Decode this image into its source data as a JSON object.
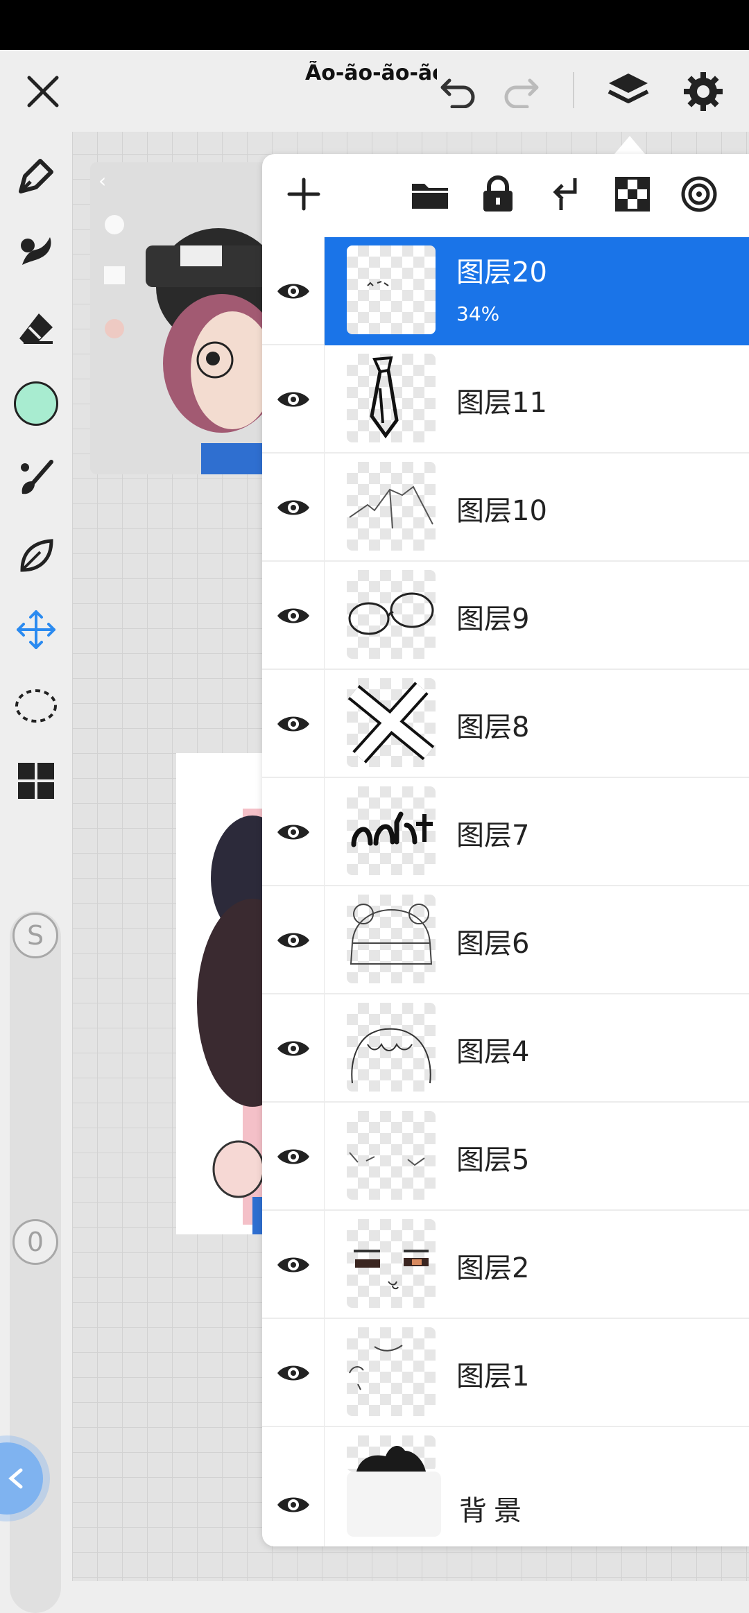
{
  "document": {
    "title": "Ão-ão-ão-ão"
  },
  "colors": {
    "accent": "#1a74e8",
    "current_color": "#a8ecd0",
    "tool_selected": "#2a8af0"
  },
  "top_bar": {
    "close_icon": "close-icon",
    "undo_icon": "undo-icon",
    "redo_icon": "redo-icon",
    "layers_icon": "layers-icon",
    "settings_icon": "gear-icon"
  },
  "left_toolbar": {
    "tools": [
      "pen-icon",
      "smudge-icon",
      "eraser-icon",
      "color-swatch",
      "brush-icon",
      "leaf-icon",
      "move-icon",
      "lasso-icon",
      "grid-icon"
    ],
    "selected_tool": "move-icon",
    "size_slider_label": "S",
    "opacity_slider_label": "0"
  },
  "layers_panel": {
    "toolbar": [
      "add-layer-icon",
      "folder-icon",
      "lock-icon",
      "merge-down-icon",
      "alpha-icon",
      "target-icon"
    ],
    "layers": [
      {
        "name": "图层20",
        "opacity": "34%",
        "selected": true,
        "alpha_lock": false,
        "thumb": "dots"
      },
      {
        "name": "图层11",
        "selected": false,
        "alpha_lock": false,
        "thumb": "tie"
      },
      {
        "name": "图层10",
        "selected": false,
        "alpha_lock": true,
        "thumb": "collar"
      },
      {
        "name": "图层9",
        "selected": false,
        "alpha_lock": false,
        "thumb": "glasses"
      },
      {
        "name": "图层8",
        "selected": false,
        "alpha_lock": false,
        "thumb": "cross"
      },
      {
        "name": "图层7",
        "selected": false,
        "alpha_lock": false,
        "thumb": "cat-text"
      },
      {
        "name": "图层6",
        "selected": false,
        "alpha_lock": false,
        "thumb": "hat"
      },
      {
        "name": "图层4",
        "selected": false,
        "alpha_lock": false,
        "thumb": "hair"
      },
      {
        "name": "图层5",
        "selected": false,
        "alpha_lock": false,
        "thumb": "lines"
      },
      {
        "name": "图层2",
        "selected": false,
        "alpha_lock": true,
        "thumb": "eyes"
      },
      {
        "name": "图层1",
        "selected": false,
        "alpha_lock": false,
        "thumb": "face"
      }
    ],
    "background": {
      "name": "背景"
    }
  }
}
